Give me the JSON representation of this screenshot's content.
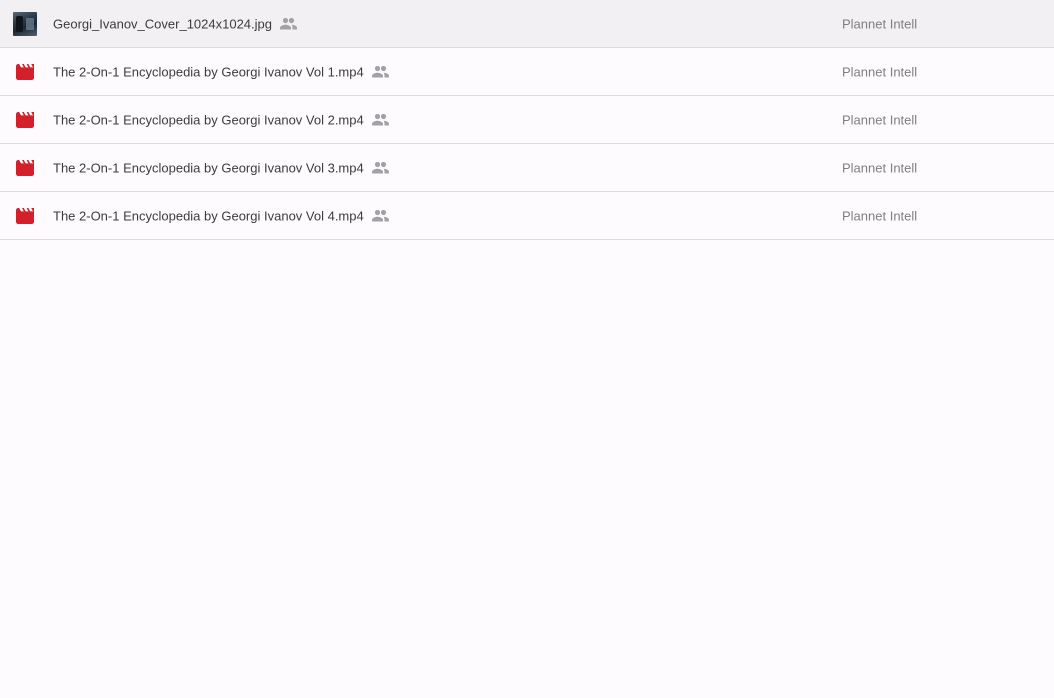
{
  "colors": {
    "background": "#fdfbfe",
    "divider": "#dcdadd",
    "video_icon": "#d3202a",
    "shared_icon": "#a3a1a5",
    "name_text": "#3c3b3d",
    "owner_text": "#807e82"
  },
  "files": [
    {
      "name": "Georgi_Ivanov_Cover_1024x1024.jpg",
      "type": "image",
      "icon": "image-thumbnail",
      "shared": true,
      "owner": "Plannet Intell"
    },
    {
      "name": "The 2-On-1 Encyclopedia by Georgi Ivanov Vol 1.mp4",
      "type": "video",
      "icon": "video-icon",
      "shared": true,
      "owner": "Plannet Intell"
    },
    {
      "name": "The 2-On-1 Encyclopedia by Georgi Ivanov Vol 2.mp4",
      "type": "video",
      "icon": "video-icon",
      "shared": true,
      "owner": "Plannet Intell"
    },
    {
      "name": "The 2-On-1 Encyclopedia by Georgi Ivanov Vol 3.mp4",
      "type": "video",
      "icon": "video-icon",
      "shared": true,
      "owner": "Plannet Intell"
    },
    {
      "name": "The 2-On-1 Encyclopedia by Georgi Ivanov Vol 4.mp4",
      "type": "video",
      "icon": "video-icon",
      "shared": true,
      "owner": "Plannet Intell"
    }
  ]
}
